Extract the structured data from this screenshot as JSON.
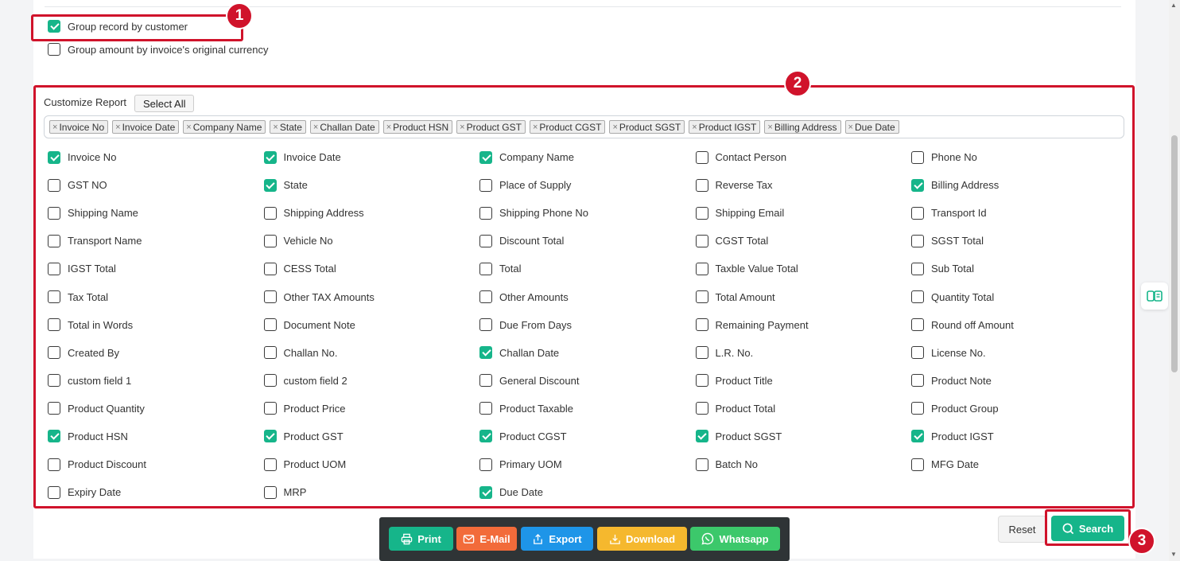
{
  "options": [
    {
      "label": "Group record by customer",
      "checked": true
    },
    {
      "label": "Group amount by invoice's original currency",
      "checked": false
    }
  ],
  "customize": {
    "label": "Customize Report",
    "select_all": "Select All",
    "tags": [
      "Invoice No",
      "Invoice Date",
      "Company Name",
      "State",
      "Challan Date",
      "Product HSN",
      "Product GST",
      "Product CGST",
      "Product SGST",
      "Product IGST",
      "Billing Address",
      "Due Date"
    ]
  },
  "fields": [
    {
      "label": "Invoice No",
      "checked": true
    },
    {
      "label": "Invoice Date",
      "checked": true
    },
    {
      "label": "Company Name",
      "checked": true
    },
    {
      "label": "Contact Person",
      "checked": false
    },
    {
      "label": "Phone No",
      "checked": false
    },
    {
      "label": "GST NO",
      "checked": false
    },
    {
      "label": "State",
      "checked": true
    },
    {
      "label": "Place of Supply",
      "checked": false
    },
    {
      "label": "Reverse Tax",
      "checked": false
    },
    {
      "label": "Billing Address",
      "checked": true
    },
    {
      "label": "Shipping Name",
      "checked": false
    },
    {
      "label": "Shipping Address",
      "checked": false
    },
    {
      "label": "Shipping Phone No",
      "checked": false
    },
    {
      "label": "Shipping Email",
      "checked": false
    },
    {
      "label": "Transport Id",
      "checked": false
    },
    {
      "label": "Transport Name",
      "checked": false
    },
    {
      "label": "Vehicle No",
      "checked": false
    },
    {
      "label": "Discount Total",
      "checked": false
    },
    {
      "label": "CGST Total",
      "checked": false
    },
    {
      "label": "SGST Total",
      "checked": false
    },
    {
      "label": "IGST Total",
      "checked": false
    },
    {
      "label": "CESS Total",
      "checked": false
    },
    {
      "label": "Total",
      "checked": false
    },
    {
      "label": "Taxble Value Total",
      "checked": false
    },
    {
      "label": "Sub Total",
      "checked": false
    },
    {
      "label": "Tax Total",
      "checked": false
    },
    {
      "label": "Other TAX Amounts",
      "checked": false
    },
    {
      "label": "Other Amounts",
      "checked": false
    },
    {
      "label": "Total Amount",
      "checked": false
    },
    {
      "label": "Quantity Total",
      "checked": false
    },
    {
      "label": "Total in Words",
      "checked": false
    },
    {
      "label": "Document Note",
      "checked": false
    },
    {
      "label": "Due From Days",
      "checked": false
    },
    {
      "label": "Remaining Payment",
      "checked": false
    },
    {
      "label": "Round off Amount",
      "checked": false
    },
    {
      "label": "Created By",
      "checked": false
    },
    {
      "label": "Challan No.",
      "checked": false
    },
    {
      "label": "Challan Date",
      "checked": true
    },
    {
      "label": "L.R. No.",
      "checked": false
    },
    {
      "label": "License No.",
      "checked": false
    },
    {
      "label": "custom field 1",
      "checked": false
    },
    {
      "label": "custom field 2",
      "checked": false
    },
    {
      "label": "General Discount",
      "checked": false
    },
    {
      "label": "Product Title",
      "checked": false
    },
    {
      "label": "Product Note",
      "checked": false
    },
    {
      "label": "Product Quantity",
      "checked": false
    },
    {
      "label": "Product Price",
      "checked": false
    },
    {
      "label": "Product Taxable",
      "checked": false
    },
    {
      "label": "Product Total",
      "checked": false
    },
    {
      "label": "Product Group",
      "checked": false
    },
    {
      "label": "Product HSN",
      "checked": true
    },
    {
      "label": "Product GST",
      "checked": true
    },
    {
      "label": "Product CGST",
      "checked": true
    },
    {
      "label": "Product SGST",
      "checked": true
    },
    {
      "label": "Product IGST",
      "checked": true
    },
    {
      "label": "Product Discount",
      "checked": false
    },
    {
      "label": "Product UOM",
      "checked": false
    },
    {
      "label": "Primary UOM",
      "checked": false
    },
    {
      "label": "Batch No",
      "checked": false
    },
    {
      "label": "MFG Date",
      "checked": false
    },
    {
      "label": "Expiry Date",
      "checked": false
    },
    {
      "label": "MRP",
      "checked": false
    },
    {
      "label": "Due Date",
      "checked": true
    }
  ],
  "buttons": {
    "reset": "Reset",
    "search": "Search"
  },
  "actions": [
    {
      "label": "Print",
      "icon": "printer-icon",
      "color": "#16b58a"
    },
    {
      "label": "E-Mail",
      "icon": "mail-icon",
      "color": "#f26b3a"
    },
    {
      "label": "Export",
      "icon": "export-icon",
      "color": "#1e95e8"
    },
    {
      "label": "Download",
      "icon": "download-icon",
      "color": "#f5b82e"
    },
    {
      "label": "Whatsapp",
      "icon": "whatsapp-icon",
      "color": "#3cc86b"
    }
  ],
  "annotations": [
    "1",
    "2",
    "3"
  ],
  "colors": {
    "accent": "#16b58a",
    "annotation": "#d0132b"
  }
}
